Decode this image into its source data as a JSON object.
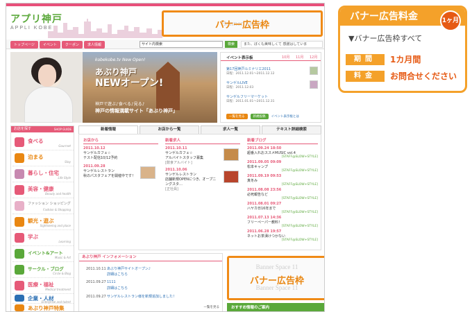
{
  "site": {
    "logo_jp": "アプリ神戸",
    "logo_en": "APPLI KOBE",
    "nav": [
      "トップページ",
      "イベント",
      "クーポン",
      "求人情報"
    ],
    "search_placeholder": "サイト内検索",
    "search_button": "検索",
    "ticker": "また、ぼくも美味しくて 感謝はしていま",
    "colors": {
      "pink": "#e65a78",
      "green": "#5aa83a",
      "orange": "#f08a16"
    }
  },
  "top_banner": {
    "ghost": "Banner Space",
    "label": "バナー広告枠"
  },
  "hero": {
    "line1": "kobekobe.tv New Open!",
    "line2": "あぶり神戸",
    "line3": "NEWオープン!",
    "line4": "神戸で遊ぶ♪食べる♪見る♪",
    "line5": "神戸の情報満載サイト「あぶり神戸」"
  },
  "events": {
    "title": "イベント表示板",
    "months": [
      "10月",
      "11月",
      "12月"
    ],
    "items": [
      {
        "title": "第17回神戸ルミナリエ2011",
        "date": "日程：2011.12.01〜2011.12.12"
      },
      {
        "title": "サンゲルLIVE",
        "date": "日程：2011.12.03"
      },
      {
        "title": "サンゲルフリーマーケット",
        "date": "日程：2011.01.01〜2011.12.31"
      }
    ],
    "btn1": "一覧を見る",
    "btn2": "新規投稿",
    "btn3": "イベント表示板とは"
  },
  "categories": {
    "header": "お店を探す",
    "header_right": "SHOP GUIDE",
    "items": [
      {
        "name": "食べる",
        "en": "Gourmet",
        "color": "#e65a78"
      },
      {
        "name": "泊まる",
        "en": "Stay",
        "color": "#e98712"
      },
      {
        "name": "暮らし・住宅",
        "en": "Life Style",
        "color": "#e65a78"
      },
      {
        "name": "美容・健康",
        "en": "Beauty and health",
        "color": "#e65a78"
      },
      {
        "name": "ファッション ショッピング",
        "en": "Fashion & Shopping",
        "color": "#e8b0c8"
      },
      {
        "name": "観光・遊ぶ",
        "en": "Sightseeing and place",
        "color": "#e98712"
      },
      {
        "name": "学ぶ",
        "en": "Learning",
        "color": "#e65a78"
      },
      {
        "name": "イベント&アート",
        "en": "Music & Art",
        "color": "#5aa83a"
      },
      {
        "name": "サークル・ブログ",
        "en": "Circle & Blog",
        "color": "#5aa83a"
      },
      {
        "name": "医療・福祉",
        "en": "Medical treatment",
        "color": "#e65a78"
      },
      {
        "name": "企業・人材",
        "en": "Enterprise and talent",
        "color": "#2b6fb3"
      },
      {
        "name": "あぶり神戸特集",
        "en": "Special",
        "color": "#e98712"
      }
    ]
  },
  "tabs": [
    "新着情報",
    "お店から一覧",
    "求人一覧",
    "テキスト詳細検索"
  ],
  "shop_news": {
    "title": "お店から",
    "items": [
      {
        "date": "2011.10.12",
        "line1": "サンゲルカフェ☆",
        "line2": "テスト配信10/12予約"
      },
      {
        "date": "2011.09.28",
        "line1": "サンゲルレストラン",
        "line2": "秋のパスタフェアを開催中です！"
      }
    ]
  },
  "jobs": {
    "title": "新着求人",
    "items": [
      {
        "date": "2011.10.11",
        "line1": "サンゲルカフェ☆",
        "line2": "アルバイトスタッフ募集",
        "line3": "[飲食アルバイト]"
      },
      {
        "date": "2011.10.06",
        "line1": "サンゲルレストラン",
        "line2": "店舗新規OPENにつき、オープニングスタ…",
        "line3": "[正社員]"
      }
    ]
  },
  "blog": {
    "title": "新着ブログ",
    "items": [
      {
        "date": "2011.09.24 18:50",
        "text": "超番入れおススメMUSIC vol.4",
        "src": "[STAFF@SLOW+STYLE]"
      },
      {
        "date": "2011.09.05 09:09",
        "text": "松本キャンプ",
        "src": "[STAFF@SLOW+STYLE]"
      },
      {
        "date": "2011.09.19 09:53",
        "text": "真冬み",
        "src": "[STAFF@SLOW+STYLE]"
      },
      {
        "date": "2011.08.08 23:56",
        "text": "必死報告など",
        "src": "[STAFF@SLOW+STYLE]"
      },
      {
        "date": "2011.08.01 09:27",
        "text": "ハヤカ日16年まで",
        "src": "[STAFF@SLOW+STYLE]"
      },
      {
        "date": "2011.07.13 14:36",
        "text": "フリーペーパー教料！",
        "src": "[STAFF@SLOW+STYLE]"
      },
      {
        "date": "2011.06.28 19:57",
        "text": "ネットお茶漬けつかない",
        "src": "[STAFF@SLOW+STYLE]"
      }
    ]
  },
  "info": {
    "title": "あぶり神戸 インフォメーション",
    "rows": [
      {
        "date": "2011.10.11",
        "line1": "あぶり神戸サイトオープン♪",
        "line2": "詳細はこちら"
      },
      {
        "date": "2011.09.27",
        "line1": "1111",
        "line2": "詳細はこちら"
      },
      {
        "date": "2011.09.27",
        "line1": "サンゲルレストラン様を新規追加しました！",
        "line2": ""
      }
    ],
    "more": "一覧を見る"
  },
  "side_banner": {
    "ghost": "Banner Space 11",
    "label": "バナー広告枠"
  },
  "recommend": "おすすめ情報のご案内",
  "pricing": {
    "title": "バナー広告料金",
    "badge": "1ヶ月",
    "desc": "▼バナー広告枠すべて",
    "period_label": "期間",
    "period_value": "1カ月間",
    "price_label": "料金",
    "price_value": "お問合せください"
  }
}
